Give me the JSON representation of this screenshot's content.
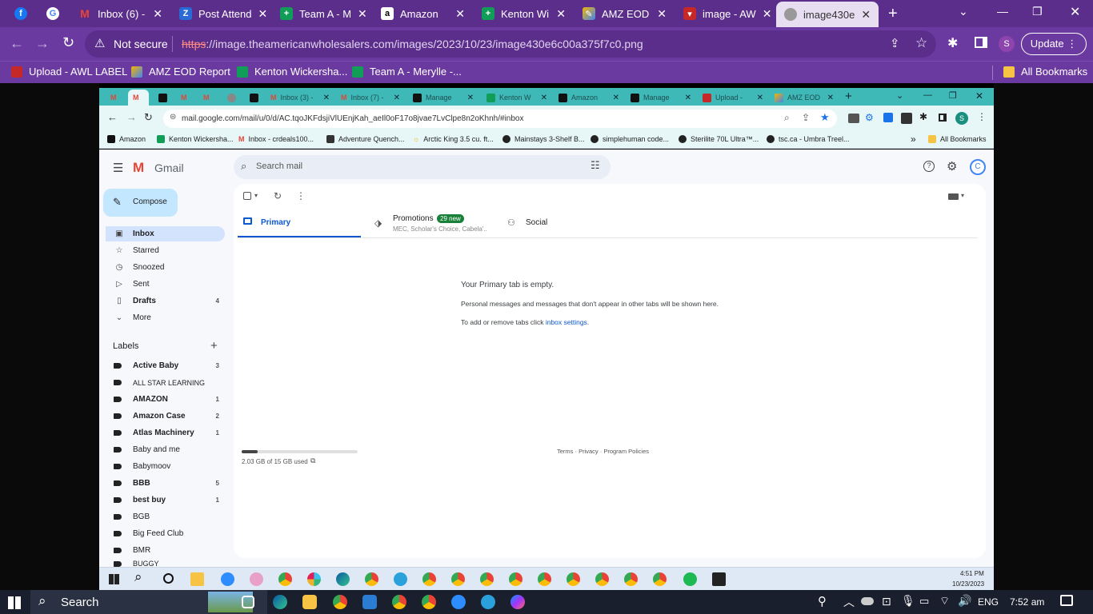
{
  "outer_browser": {
    "tabs": [
      {
        "label": "",
        "icon": "facebook-icon"
      },
      {
        "label": "",
        "icon": "google-icon"
      },
      {
        "label": "Inbox (6) -",
        "icon": "gmail-icon"
      },
      {
        "label": "Post Attend",
        "icon": "zoho-icon"
      },
      {
        "label": "Team A - M",
        "icon": "sheets-icon"
      },
      {
        "label": "Amazon",
        "icon": "amazon-icon"
      },
      {
        "label": "Kenton Wi",
        "icon": "sheets-icon"
      },
      {
        "label": "AMZ EOD",
        "icon": "pencil-app-icon"
      },
      {
        "label": "image - AW",
        "icon": "awl-icon"
      },
      {
        "label": "image430e",
        "icon": "globe-icon"
      }
    ],
    "security_label": "Not secure",
    "url_https": "https",
    "url_rest": "://image.theamericanwholesalers.com/images/2023/10/23/image430e6c00a375f7c0.png",
    "profile_initial": "S",
    "update_label": "Update",
    "bookmarks": [
      {
        "label": "Upload - AWL LABEL",
        "icon": "awl-icon"
      },
      {
        "label": "AMZ EOD Report",
        "icon": "pencil-app-icon"
      },
      {
        "label": "Kenton Wickersha...",
        "icon": "sheets-icon"
      },
      {
        "label": "Team A - Merylle -...",
        "icon": "sheets-icon"
      }
    ],
    "all_bookmarks": "All Bookmarks"
  },
  "inner_browser": {
    "tabs": [
      {
        "label": "",
        "icon": "gmail-icon"
      },
      {
        "label": "",
        "icon": "gmail-icon"
      },
      {
        "label": "",
        "icon": "amazon-icon"
      },
      {
        "label": "",
        "icon": "gmail-icon"
      },
      {
        "label": "",
        "icon": "gmail-icon"
      },
      {
        "label": "",
        "icon": "globe-icon"
      },
      {
        "label": "",
        "icon": "amazon-icon"
      },
      {
        "label": "Inbox (3) -",
        "icon": "gmail-icon"
      },
      {
        "label": "Inbox (7) -",
        "icon": "gmail-icon"
      },
      {
        "label": "Manage",
        "icon": "amazon-icon"
      },
      {
        "label": "Kenton W",
        "icon": "sheets-icon"
      },
      {
        "label": "Amazon",
        "icon": "amazon-icon"
      },
      {
        "label": "Manage",
        "icon": "amazon-icon"
      },
      {
        "label": "Upload -",
        "icon": "awl-icon"
      },
      {
        "label": "AMZ EOD",
        "icon": "pencil-app-icon"
      }
    ],
    "url": "mail.google.com/mail/u/0/d/AC.tqoJKFdsjiVlUEnjKah_aeIl0oF17o8jvae7LvClpe8n2oKhnh/#inbox",
    "profile_initial": "S",
    "bookmarks": [
      "Amazon",
      "Kenton Wickersha...",
      "Inbox - crdeals100...",
      "Adventure Quench...",
      "Arctic King 3.5 cu. ft...",
      "Mainstays 3-Shelf B...",
      "simplehuman code...",
      "Sterilite 70L Ultra™...",
      "tsc.ca - Umbra Treel..."
    ],
    "more_bookmarks": "»",
    "all_bookmarks": "All Bookmarks"
  },
  "gmail": {
    "logo_text": "Gmail",
    "search_placeholder": "Search mail",
    "avatar_initial": "C",
    "compose_label": "Compose",
    "nav": [
      {
        "label": "Inbox",
        "count": "",
        "icon": "inbox-icon",
        "active": true
      },
      {
        "label": "Starred",
        "count": "",
        "icon": "star-icon"
      },
      {
        "label": "Snoozed",
        "count": "",
        "icon": "clock-icon"
      },
      {
        "label": "Sent",
        "count": "",
        "icon": "send-icon"
      },
      {
        "label": "Drafts",
        "count": "4",
        "icon": "draft-icon",
        "bold": true
      },
      {
        "label": "More",
        "count": "",
        "icon": "chevron-down-icon"
      }
    ],
    "labels_heading": "Labels",
    "labels": [
      {
        "label": "Active Baby",
        "count": "3",
        "bold": true
      },
      {
        "label": "ALL STAR LEARNING",
        "count": ""
      },
      {
        "label": "AMAZON",
        "count": "1",
        "bold": true
      },
      {
        "label": "Amazon Case",
        "count": "2",
        "bold": true
      },
      {
        "label": "Atlas Machinery",
        "count": "1",
        "bold": true
      },
      {
        "label": "Baby and me",
        "count": ""
      },
      {
        "label": "Babymoov",
        "count": ""
      },
      {
        "label": "BBB",
        "count": "5",
        "bold": true
      },
      {
        "label": "best buy",
        "count": "1",
        "bold": true
      },
      {
        "label": "BGB",
        "count": ""
      },
      {
        "label": "Big Feed Club",
        "count": ""
      },
      {
        "label": "BMR",
        "count": ""
      },
      {
        "label": "BUGGY",
        "count": ""
      }
    ],
    "tabs": {
      "primary": "Primary",
      "promotions": "Promotions",
      "promotions_badge": "29 new",
      "promotions_sub": "MEC, Scholar's Choice, Cabela'...",
      "social": "Social"
    },
    "empty": {
      "title": "Your Primary tab is empty.",
      "line1": "Personal messages and messages that don't appear in other tabs will be shown here.",
      "line2_prefix": "To add or remove tabs click ",
      "line2_link": "inbox settings",
      "line2_suffix": "."
    },
    "storage_text": "2.03 GB of 15 GB used",
    "storage_fraction": 0.135,
    "footer_links": "Terms · Privacy · Program Policies"
  },
  "inner_taskbar": {
    "time": "4:51 PM",
    "date": "10/23/2023"
  },
  "outer_taskbar": {
    "search_label": "Search",
    "language": "ENG",
    "time": "7:52 am"
  }
}
